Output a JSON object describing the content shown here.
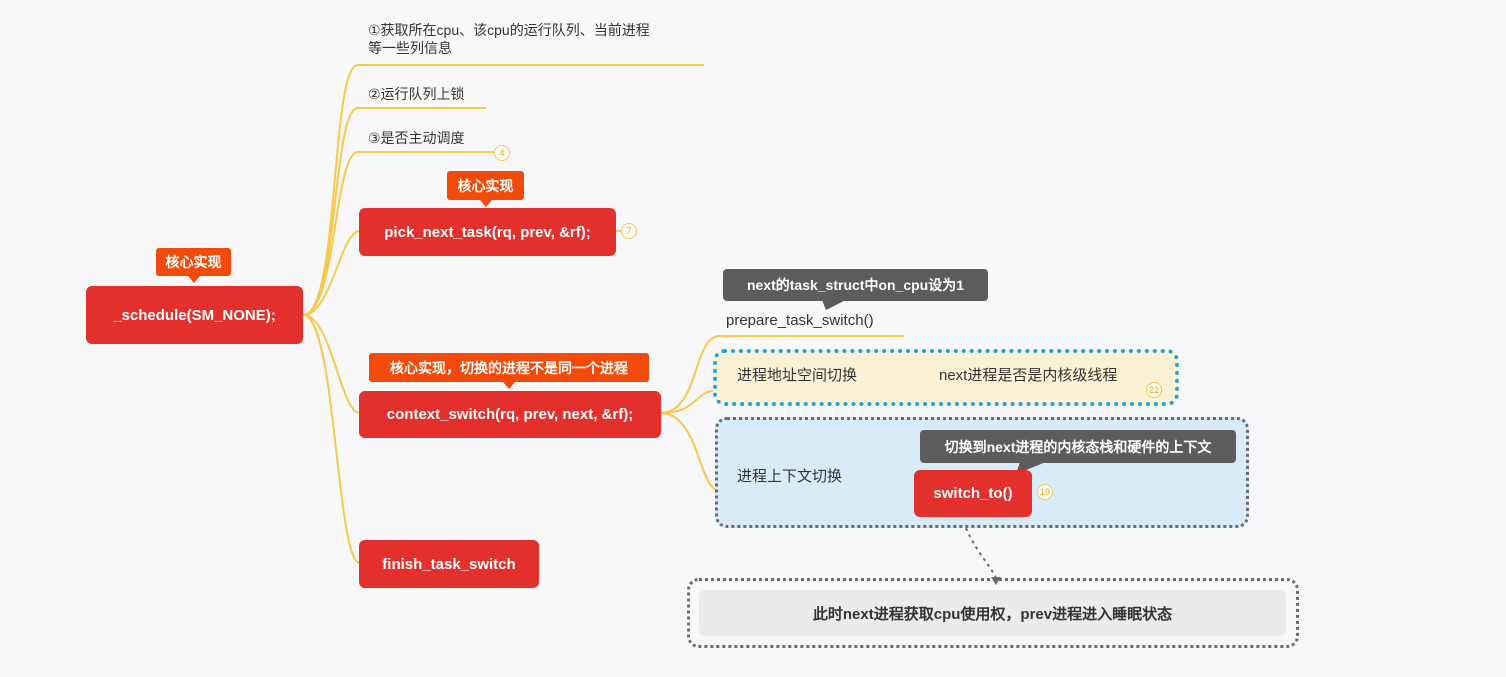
{
  "root": {
    "label": "_schedule(SM_NONE);",
    "tag": "核心实现"
  },
  "branches": {
    "step1": {
      "line1": "①获取所在cpu、该cpu的运行队列、当前进程",
      "line2": "等一些列信息"
    },
    "step2": {
      "label": "②运行队列上锁"
    },
    "step3": {
      "label": "③是否主动调度",
      "badge": "4"
    },
    "pick": {
      "label": "pick_next_task(rq, prev, &rf);",
      "tag": "核心实现",
      "badge": "7"
    },
    "context": {
      "label": "context_switch(rq, prev, next, &rf);",
      "tag": "核心实现，切换的进程不是同一个进程"
    },
    "finish": {
      "label": "finish_task_switch"
    }
  },
  "context_children": {
    "prepare": {
      "label": "prepare_task_switch()",
      "callout": "next的task_struct中on_cpu设为1"
    },
    "addr": {
      "label": "进程地址空间切换",
      "child": "next进程是否是内核级线程",
      "badge": "22"
    },
    "ctx": {
      "label": "进程上下文切换",
      "child": "switch_to()",
      "callout": "切换到next进程的内核态栈和硬件的上下文",
      "badge": "19"
    }
  },
  "summary": {
    "label": "此时next进程获取cpu使用权，prev进程进入睡眠状态"
  },
  "colors": {
    "node": "#e3302c",
    "tag": "#f24a08",
    "line": "#f7c84a",
    "dotted_blue": "#1aa3e8"
  }
}
